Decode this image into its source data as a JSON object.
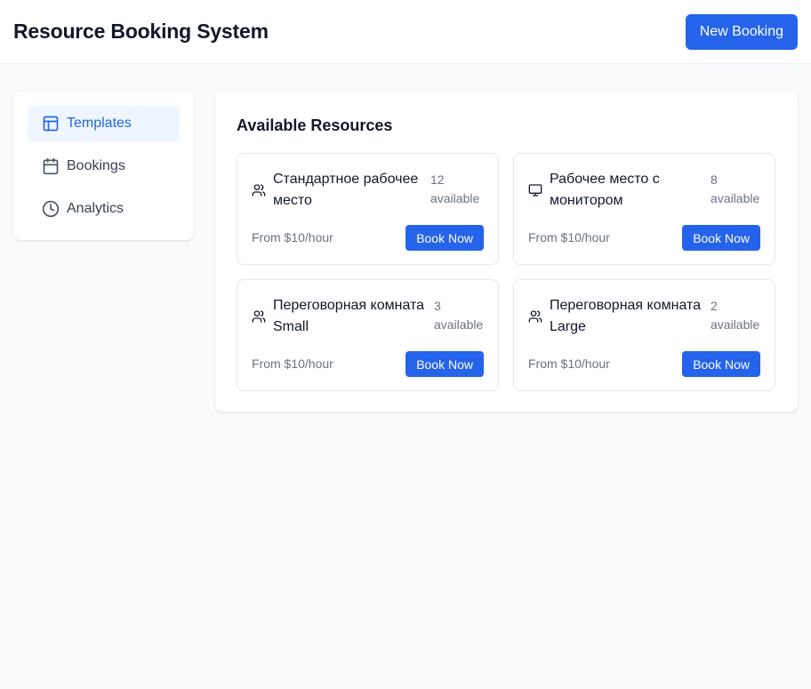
{
  "header": {
    "title": "Resource Booking System",
    "new_booking_label": "New Booking"
  },
  "sidebar": {
    "items": [
      {
        "label": "Templates",
        "icon": "layout-icon",
        "active": true
      },
      {
        "label": "Bookings",
        "icon": "calendar-icon",
        "active": false
      },
      {
        "label": "Analytics",
        "icon": "clock-icon",
        "active": false
      }
    ]
  },
  "main": {
    "title": "Available Resources",
    "resources": [
      {
        "name": "Стандартное рабочее место",
        "count": "12",
        "count_label": "available",
        "price": "From $10/hour",
        "action": "Book Now",
        "icon": "users-icon"
      },
      {
        "name": "Рабочее место с монитором",
        "count": "8",
        "count_label": "available",
        "price": "From $10/hour",
        "action": "Book Now",
        "icon": "monitor-icon"
      },
      {
        "name": "Переговорная комната Small",
        "count": "3",
        "count_label": "available",
        "price": "From $10/hour",
        "action": "Book Now",
        "icon": "users-icon"
      },
      {
        "name": "Переговорная комната Large",
        "count": "2",
        "count_label": "available",
        "price": "From $10/hour",
        "action": "Book Now",
        "icon": "users-icon"
      }
    ]
  },
  "colors": {
    "accent": "#2563eb",
    "active_bg": "#eff6ff",
    "muted_text": "#6b7280",
    "background": "#f9fafb"
  }
}
